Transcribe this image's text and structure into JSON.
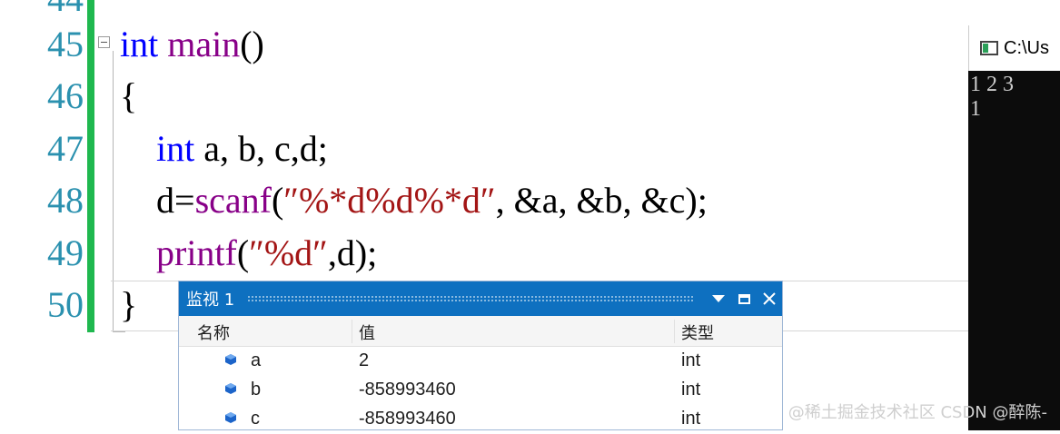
{
  "editor": {
    "line_numbers": [
      "44",
      "45",
      "46",
      "47",
      "48",
      "49",
      "50"
    ],
    "code": {
      "l45_kw": "int",
      "l45_fn": " main",
      "l45_rest": "()",
      "l46": "{",
      "l47_indent": "    ",
      "l47_kw": "int",
      "l47_rest": " a, b, c,d;",
      "l48_pre": "    d=",
      "l48_fn": "scanf",
      "l48_open": "(",
      "l48_str": "″%*d%d%*d″",
      "l48_rest": ", &a, &b, &c);",
      "l49_indent": "    ",
      "l49_fn": "printf",
      "l49_open": "(",
      "l49_str": "″%d″",
      "l49_rest": ",d);",
      "l50": "}"
    },
    "colors": {
      "keyword": "#0000ff",
      "function": "#880088",
      "string": "#a31515",
      "line_number": "#2b91af",
      "change_bar": "#1fb84f"
    }
  },
  "console": {
    "title": "C:\\Us",
    "output_line1": "1 2 3",
    "output_line2": "1"
  },
  "watch": {
    "title": "监视 1",
    "columns": {
      "name": "名称",
      "value": "值",
      "type": "类型"
    },
    "rows": [
      {
        "name": "a",
        "value": "2",
        "type": "int",
        "icon": "variable-cube-icon"
      },
      {
        "name": "b",
        "value": "-858993460",
        "type": "int",
        "icon": "variable-cube-icon"
      },
      {
        "name": "c",
        "value": "-858993460",
        "type": "int",
        "icon": "variable-cube-icon"
      }
    ],
    "accent": "#0e70c0"
  },
  "watermark": "@稀土掘金技术社区 CSDN @醉陈-"
}
